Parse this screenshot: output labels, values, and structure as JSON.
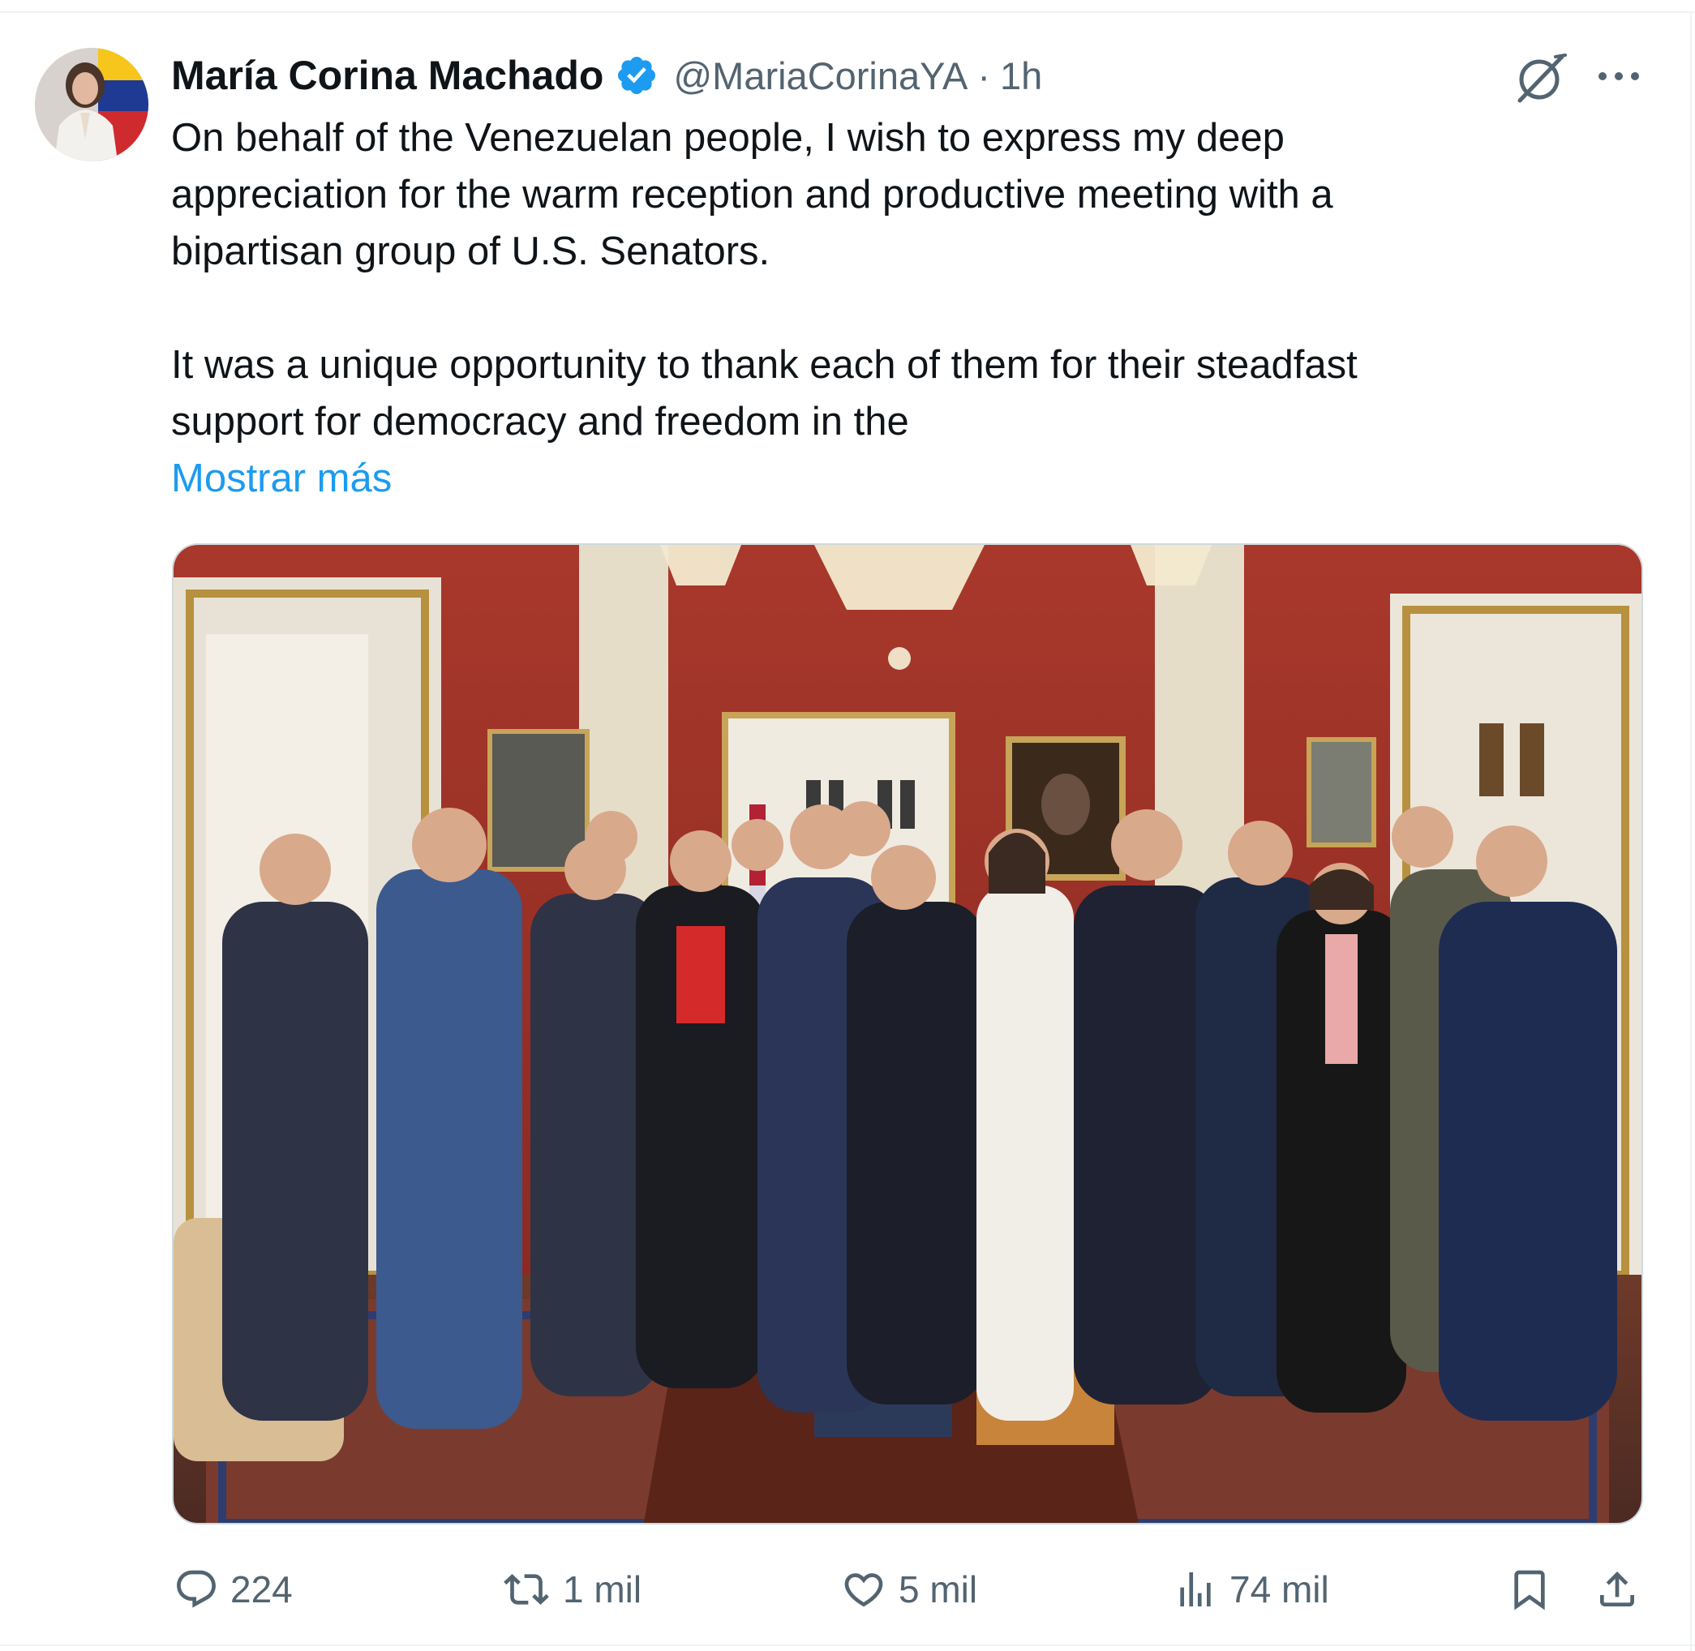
{
  "tweet": {
    "author": {
      "display_name": "María Corina Machado",
      "handle": "@MariaCorinaYA",
      "separator": "·",
      "time": "1h",
      "verified": true
    },
    "text": "On behalf of the Venezuelan people, I wish to express my deep\nappreciation for the warm reception and productive meeting with a\nbipartisan group of U.S. Senators.\n\nIt was a unique opportunity to thank each of them for their steadfast\nsupport for democracy and freedom in the",
    "show_more_label": "Mostrar más",
    "media": {
      "type": "photo",
      "description_icon": "photo"
    },
    "actions": {
      "replies": "224",
      "reposts": "1 mil",
      "likes": "5 mil",
      "views": "74 mil"
    }
  },
  "colors": {
    "text_primary": "#0f1419",
    "text_secondary": "#536471",
    "link": "#1d9bf0",
    "verified": "#1d9bf0",
    "border": "#cfd9de"
  },
  "icons": {
    "reply": "reply-icon",
    "repost": "repost-icon",
    "like": "heart-icon",
    "views": "views-chart-icon",
    "bookmark": "bookmark-icon",
    "share": "share-icon",
    "grok": "grok-icon",
    "more": "more-icon",
    "verified": "verified-badge-icon"
  }
}
